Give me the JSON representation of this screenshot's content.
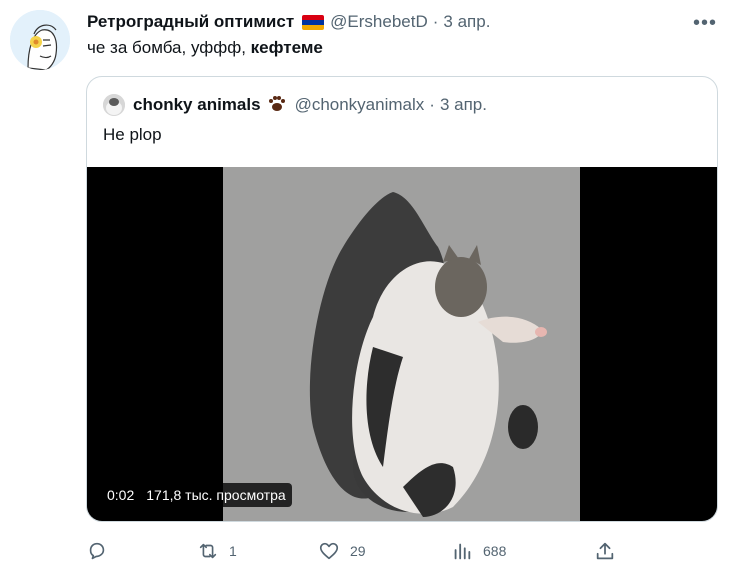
{
  "tweet": {
    "author_name": "Ретроградный оптимист",
    "handle": "@ErshebetD",
    "separator": "·",
    "date": "3 апр.",
    "text_plain": "че за бомба, уффф, ",
    "text_bold": "кефтеме"
  },
  "quote": {
    "author_name": "chonky animals",
    "handle": "@chonkyanimalx",
    "separator": "·",
    "date": "3 апр.",
    "text": "He plop",
    "video": {
      "time": "0:02",
      "views": "171,8 тыс. просмотра"
    }
  },
  "actions": {
    "reply_count": "",
    "retweet_count": "1",
    "like_count": "29",
    "view_count": "688"
  },
  "colors": {
    "muted": "#536471",
    "border": "#cfd9de",
    "flag": [
      "#d90012",
      "#0033a0",
      "#f2a800"
    ]
  },
  "icons": [
    "more-icon",
    "flag-armenia-icon",
    "paw-icon",
    "reply-icon",
    "retweet-icon",
    "like-icon",
    "views-icon",
    "share-icon"
  ]
}
